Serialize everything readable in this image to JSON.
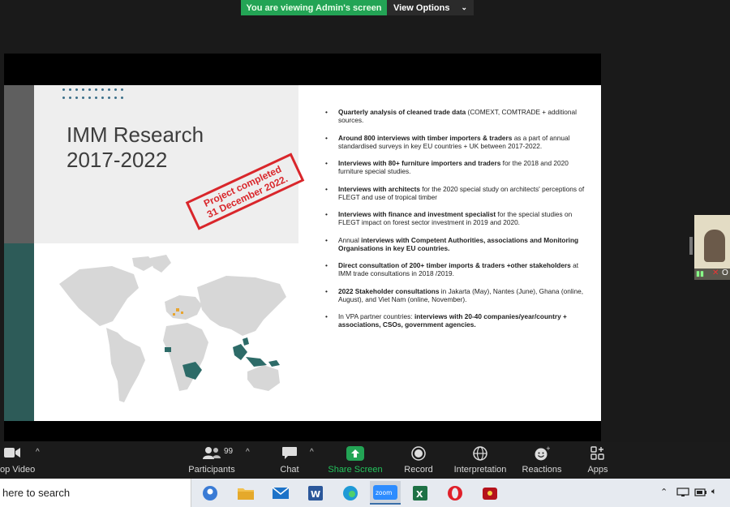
{
  "banner": {
    "viewing_text": "You are viewing Admin's screen",
    "view_options_label": "View Options"
  },
  "slide": {
    "title_line1": "IMM Research",
    "title_line2": "2017-2022",
    "stamp_line1": "Project completed",
    "stamp_line2": "31 December 2022.",
    "bullets": [
      {
        "bold": "Quarterly analysis of cleaned trade data",
        "rest": " (COMEXT, COMTRADE + additional sources."
      },
      {
        "bold": "Around 800 interviews with timber importers & traders",
        "rest": " as a part of annual standardised surveys in key EU countries + UK between 2017-2022."
      },
      {
        "bold": "Interviews with 80+ furniture importers and traders",
        "rest": " for the 2018 and 2020 furniture special studies."
      },
      {
        "bold": "Interviews with architects",
        "rest": " for the 2020 special study on architects' perceptions of FLEGT and use of tropical timber"
      },
      {
        "bold": "Interviews with finance and investment specialist",
        "rest": " for the special studies on FLEGT impact on forest sector investment in 2019 and 2020."
      },
      {
        "pre": "Annual ",
        "bold": "interviews with Competent Authorities, associations and Monitoring Organisations in key EU countries.",
        "rest": ""
      },
      {
        "bold": "Direct consultation of 200+ timber imports & traders +other stakeholders",
        "rest": " at IMM trade consultations in 2018 /2019."
      },
      {
        "bold": "2022 Stakeholder consultations",
        "rest": " in Jakarta (May), Nantes (June), Ghana (online, August), and Viet Nam (online, November)."
      },
      {
        "pre": "In VPA partner countries: ",
        "bold": "interviews with 20-40 companies/year/country + associations, CSOs, government agencies.",
        "rest": ""
      }
    ]
  },
  "thumbnail": {
    "name_initial": "O"
  },
  "toolbar": {
    "video_label": "op Video",
    "participants_label": "Participants",
    "participants_count": "99",
    "chat_label": "Chat",
    "share_label": "Share Screen",
    "record_label": "Record",
    "interpretation_label": "Interpretation",
    "reactions_label": "Reactions",
    "apps_label": "Apps"
  },
  "taskbar": {
    "search_placeholder": "here to search",
    "apps": [
      "people-icon",
      "file-explorer-icon",
      "mail-icon",
      "word-icon",
      "edge-icon",
      "zoom-icon",
      "excel-icon",
      "opera-icon",
      "game-icon"
    ],
    "zoom_label": "zoom"
  },
  "colors": {
    "share_green": "#23a455",
    "slide_teal": "#2d5b58",
    "stamp_red": "#d9262b"
  }
}
